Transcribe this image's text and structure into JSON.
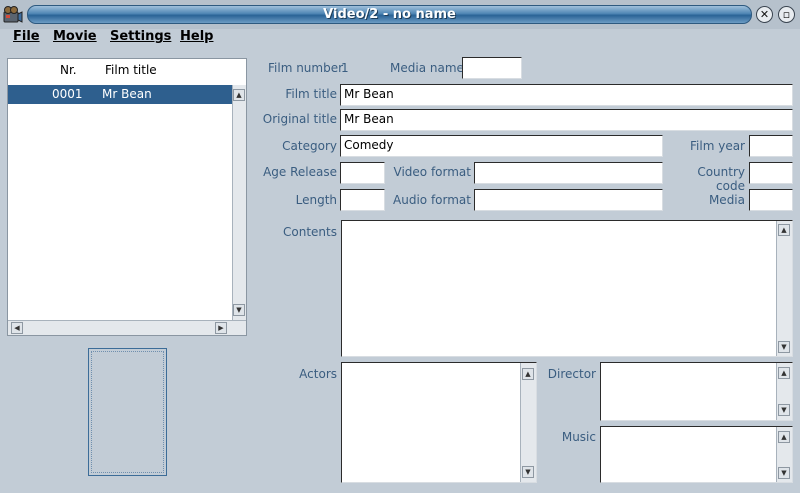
{
  "window": {
    "title": "Video/2 - no name",
    "app_icon": "film-camera-icon"
  },
  "menu": [
    "File",
    "Movie",
    "Settings",
    "Help"
  ],
  "list": {
    "columns": [
      "Nr.",
      "Film title"
    ],
    "rows": [
      {
        "nr": "0001",
        "title": "Mr Bean",
        "selected": true
      }
    ]
  },
  "form": {
    "film_number_label": "Film number",
    "film_number_value": "1",
    "media_name_label": "Media name",
    "media_name_value": "",
    "film_title_label": "Film title",
    "film_title_value": "Mr Bean",
    "original_title_label": "Original title",
    "original_title_value": "Mr Bean",
    "category_label": "Category",
    "category_value": "Comedy",
    "film_year_label": "Film year",
    "film_year_value": "",
    "age_release_label": "Age Release",
    "age_release_value": "",
    "video_format_label": "Video format",
    "video_format_value": "",
    "country_code_label": "Country code",
    "country_code_value": "",
    "length_label": "Length",
    "length_value": "",
    "audio_format_label": "Audio format",
    "audio_format_value": "",
    "media_label": "Media",
    "media_value": "",
    "contents_label": "Contents",
    "actors_label": "Actors",
    "director_label": "Director",
    "music_label": "Music"
  },
  "colors": {
    "selection": "#2e5f8e",
    "label_text": "#3a5d80",
    "background": "#c2ccd6"
  }
}
